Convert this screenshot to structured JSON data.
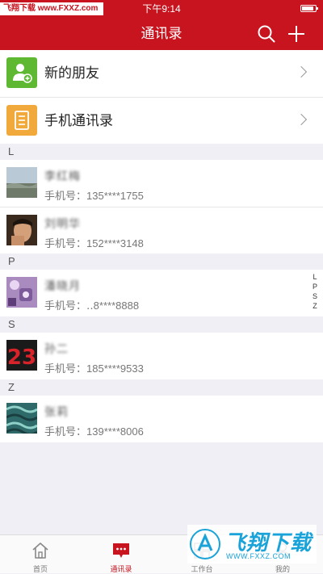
{
  "status_bar": {
    "brand": "飞翔下载 www.FXXZ.com",
    "time": "下午9:14"
  },
  "navbar": {
    "title": "通讯录",
    "search_icon": "search-icon",
    "add_icon": "plus-icon"
  },
  "top_items": [
    {
      "label": "新的朋友",
      "icon": "add-contact-icon",
      "color": "#5fb832"
    },
    {
      "label": "手机通讯录",
      "icon": "phonebook-icon",
      "color": "#f2a93b"
    }
  ],
  "sections": [
    {
      "letter": "L",
      "contacts": [
        {
          "name": "李红梅",
          "phone": "手机号：135****1755"
        },
        {
          "name": "刘明华",
          "phone": "手机号：152****3148"
        }
      ]
    },
    {
      "letter": "P",
      "contacts": [
        {
          "name": "潘晓月",
          "phone": "手机号：‥8****8888"
        }
      ]
    },
    {
      "letter": "S",
      "contacts": [
        {
          "name": "孙二",
          "phone": "手机号：185****9533"
        }
      ]
    },
    {
      "letter": "Z",
      "contacts": [
        {
          "name": "张莉",
          "phone": "手机号：139****8006"
        }
      ]
    }
  ],
  "index_bar": [
    "L",
    "P",
    "S",
    "Z"
  ],
  "tabbar": [
    {
      "label": "首页",
      "icon": "home-icon",
      "active": false
    },
    {
      "label": "通讯录",
      "icon": "chat-icon",
      "active": true
    },
    {
      "label": "工作台",
      "icon": "workbench-icon",
      "active": false
    },
    {
      "label": "我的",
      "icon": "profile-icon",
      "active": false
    }
  ],
  "watermark": {
    "text": "飞翔下载",
    "url": "WWW.FXXZ.COM"
  },
  "colors": {
    "accent": "#c8141f",
    "background": "#f0eff5"
  }
}
